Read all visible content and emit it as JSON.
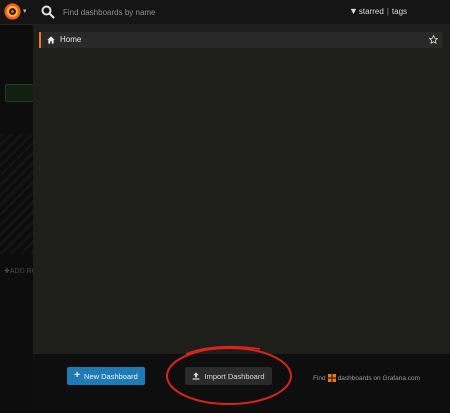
{
  "search": {
    "placeholder": "Find dashboards by name"
  },
  "filters": {
    "starred_label": "starred",
    "separator": "|",
    "tags_label": "tags"
  },
  "results": [
    {
      "label": "Home",
      "icon": "home-icon",
      "starred": false
    }
  ],
  "footer": {
    "new_dashboard_label": "New Dashboard",
    "import_dashboard_label": "Import Dashboard",
    "find_prefix": "Find",
    "find_link": "dashboards on Grafana.com"
  },
  "background": {
    "add_row_label": "ADD RO"
  },
  "colors": {
    "accent_orange": "#eb7b18",
    "primary_blue": "#1f7bb6",
    "annotation_red": "#d9241c"
  }
}
